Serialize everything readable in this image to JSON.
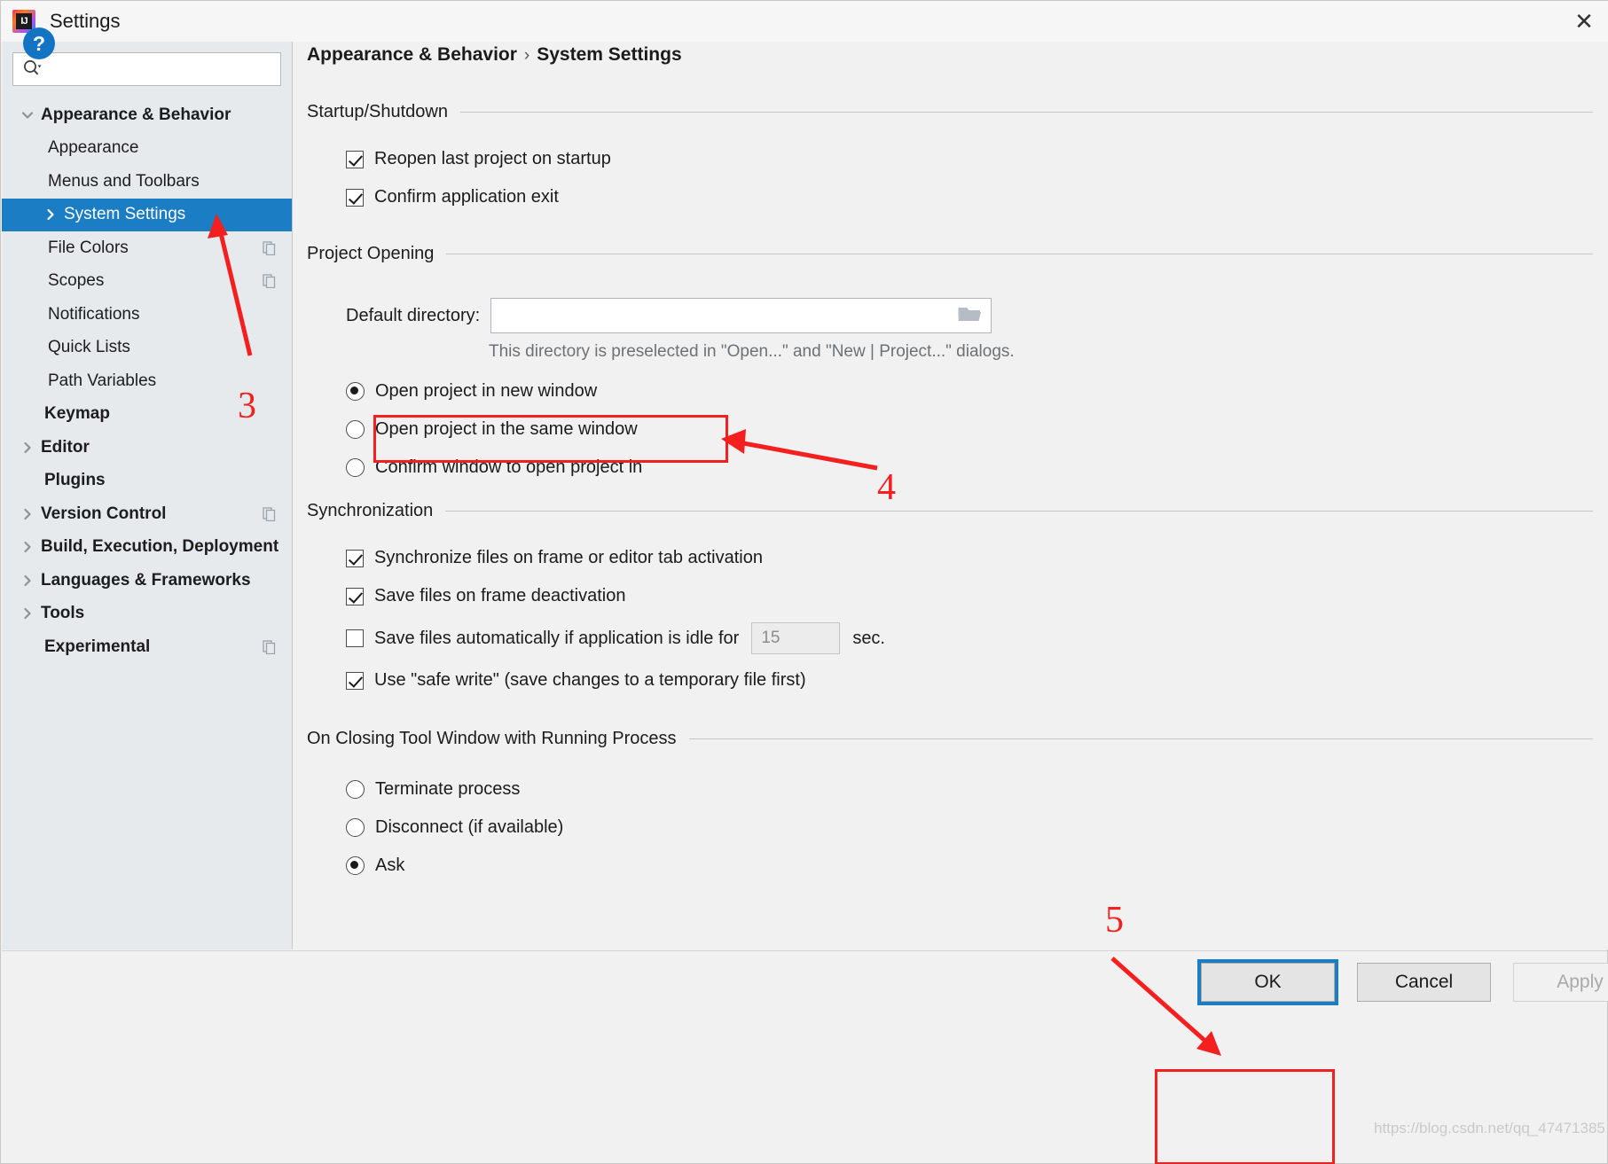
{
  "window": {
    "title": "Settings",
    "logo_icon": "intellij-idea-logo",
    "close_icon": "close-icon"
  },
  "search": {
    "value": "",
    "placeholder": "",
    "icon": "search-icon"
  },
  "sidebar": {
    "items": [
      {
        "label": "Appearance & Behavior",
        "level": 0,
        "arrow": "chevron-down",
        "bold": true,
        "selected": false,
        "badge": false
      },
      {
        "label": "Appearance",
        "level": 1,
        "arrow": "none",
        "bold": false,
        "selected": false,
        "badge": false
      },
      {
        "label": "Menus and Toolbars",
        "level": 1,
        "arrow": "none",
        "bold": false,
        "selected": false,
        "badge": false
      },
      {
        "label": "System Settings",
        "level": 1,
        "arrow": "chevron-right",
        "bold": false,
        "selected": true,
        "badge": false
      },
      {
        "label": "File Colors",
        "level": 1,
        "arrow": "none",
        "bold": false,
        "selected": false,
        "badge": true
      },
      {
        "label": "Scopes",
        "level": 1,
        "arrow": "none",
        "bold": false,
        "selected": false,
        "badge": true
      },
      {
        "label": "Notifications",
        "level": 1,
        "arrow": "none",
        "bold": false,
        "selected": false,
        "badge": false
      },
      {
        "label": "Quick Lists",
        "level": 1,
        "arrow": "none",
        "bold": false,
        "selected": false,
        "badge": false
      },
      {
        "label": "Path Variables",
        "level": 1,
        "arrow": "none",
        "bold": false,
        "selected": false,
        "badge": false
      },
      {
        "label": "Keymap",
        "level": 0,
        "arrow": "none",
        "bold": true,
        "selected": false,
        "badge": false
      },
      {
        "label": "Editor",
        "level": 0,
        "arrow": "chevron-right",
        "bold": true,
        "selected": false,
        "badge": false
      },
      {
        "label": "Plugins",
        "level": 0,
        "arrow": "none",
        "bold": true,
        "selected": false,
        "badge": false
      },
      {
        "label": "Version Control",
        "level": 0,
        "arrow": "chevron-right",
        "bold": true,
        "selected": false,
        "badge": true
      },
      {
        "label": "Build, Execution, Deployment",
        "level": 0,
        "arrow": "chevron-right",
        "bold": true,
        "selected": false,
        "badge": false
      },
      {
        "label": "Languages & Frameworks",
        "level": 0,
        "arrow": "chevron-right",
        "bold": true,
        "selected": false,
        "badge": false
      },
      {
        "label": "Tools",
        "level": 0,
        "arrow": "chevron-right",
        "bold": true,
        "selected": false,
        "badge": false
      },
      {
        "label": "Experimental",
        "level": 0,
        "arrow": "none",
        "bold": true,
        "selected": false,
        "badge": true
      }
    ]
  },
  "breadcrumb": {
    "root": "Appearance & Behavior",
    "separator": "›",
    "leaf": "System Settings"
  },
  "sections": {
    "startup": {
      "title": "Startup/Shutdown",
      "options": [
        {
          "label": "Reopen last project on startup",
          "checked": true
        },
        {
          "label": "Confirm application exit",
          "checked": true
        }
      ]
    },
    "project_opening": {
      "title": "Project Opening",
      "default_directory_label": "Default directory:",
      "default_directory_value": "",
      "default_directory_placeholder": "",
      "browse_icon": "folder-icon",
      "hint": "This directory is preselected in \"Open...\" and \"New | Project...\" dialogs.",
      "radios": [
        {
          "label": "Open project in new window",
          "checked": true
        },
        {
          "label": "Open project in the same window",
          "checked": false
        },
        {
          "label": "Confirm window to open project in",
          "checked": false
        }
      ]
    },
    "synchronization": {
      "title": "Synchronization",
      "options": [
        {
          "label": "Synchronize files on frame or editor tab activation",
          "checked": true
        },
        {
          "label": "Save files on frame deactivation",
          "checked": true
        }
      ],
      "idle": {
        "label": "Save files automatically if application is idle for",
        "checked": false,
        "value": "15",
        "unit": "sec."
      },
      "safe_write": {
        "label": "Use \"safe write\" (save changes to a temporary file first)",
        "checked": true
      }
    },
    "closing_tool_window": {
      "title": "On Closing Tool Window with Running Process",
      "radios": [
        {
          "label": "Terminate process",
          "checked": false
        },
        {
          "label": "Disconnect (if available)",
          "checked": false
        },
        {
          "label": "Ask",
          "checked": true
        }
      ]
    }
  },
  "footer": {
    "help_label": "?",
    "ok_label": "OK",
    "cancel_label": "Cancel",
    "apply_label": "Apply"
  },
  "annotations": {
    "markers": [
      {
        "id": "3",
        "text": "3"
      },
      {
        "id": "4",
        "text": "4"
      },
      {
        "id": "5",
        "text": "5"
      }
    ],
    "color": "#f41f1f"
  },
  "watermark": "https://blog.csdn.net/qq_47471385",
  "colors": {
    "accent": "#1b7dc4",
    "sidebar_bg": "#e6eaed",
    "panel_bg": "#f1f1f1",
    "annotation": "#f41f1f"
  }
}
